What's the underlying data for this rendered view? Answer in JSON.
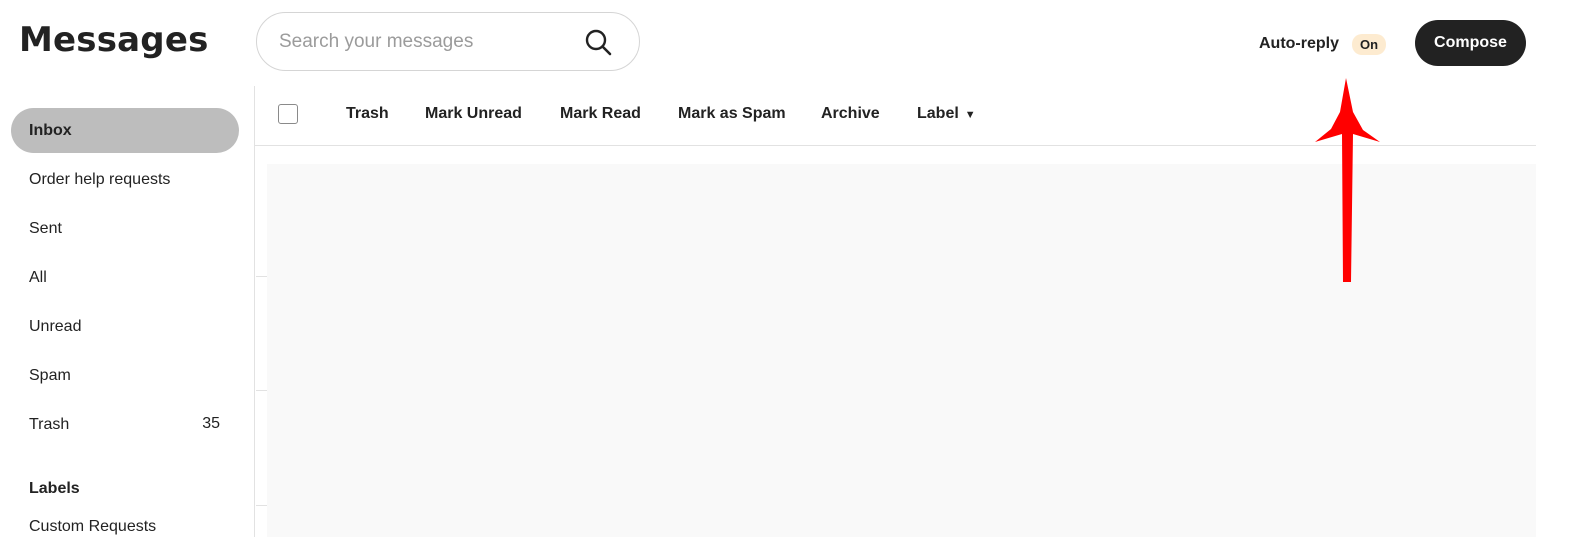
{
  "header": {
    "title": "Messages",
    "search_placeholder": "Search your messages",
    "search_icon": "search-icon",
    "auto_reply_label": "Auto-reply",
    "auto_reply_status": "On",
    "compose_label": "Compose"
  },
  "sidebar": {
    "items": [
      {
        "label": "Inbox",
        "active": true
      },
      {
        "label": "Order help requests"
      },
      {
        "label": "Sent"
      },
      {
        "label": "All"
      },
      {
        "label": "Unread"
      },
      {
        "label": "Spam"
      },
      {
        "label": "Trash",
        "count": "35"
      }
    ],
    "labels_heading": "Labels",
    "labels": [
      "Custom Requests"
    ]
  },
  "toolbar": {
    "trash": "Trash",
    "mark_unread": "Mark Unread",
    "mark_read": "Mark Read",
    "mark_spam": "Mark as Spam",
    "archive": "Archive",
    "label": "Label"
  },
  "colors": {
    "compose_bg": "#222222",
    "active_item_bg": "#bdbdbd",
    "badge_bg": "#fdebd0",
    "annotation_arrow": "#ff0000"
  }
}
